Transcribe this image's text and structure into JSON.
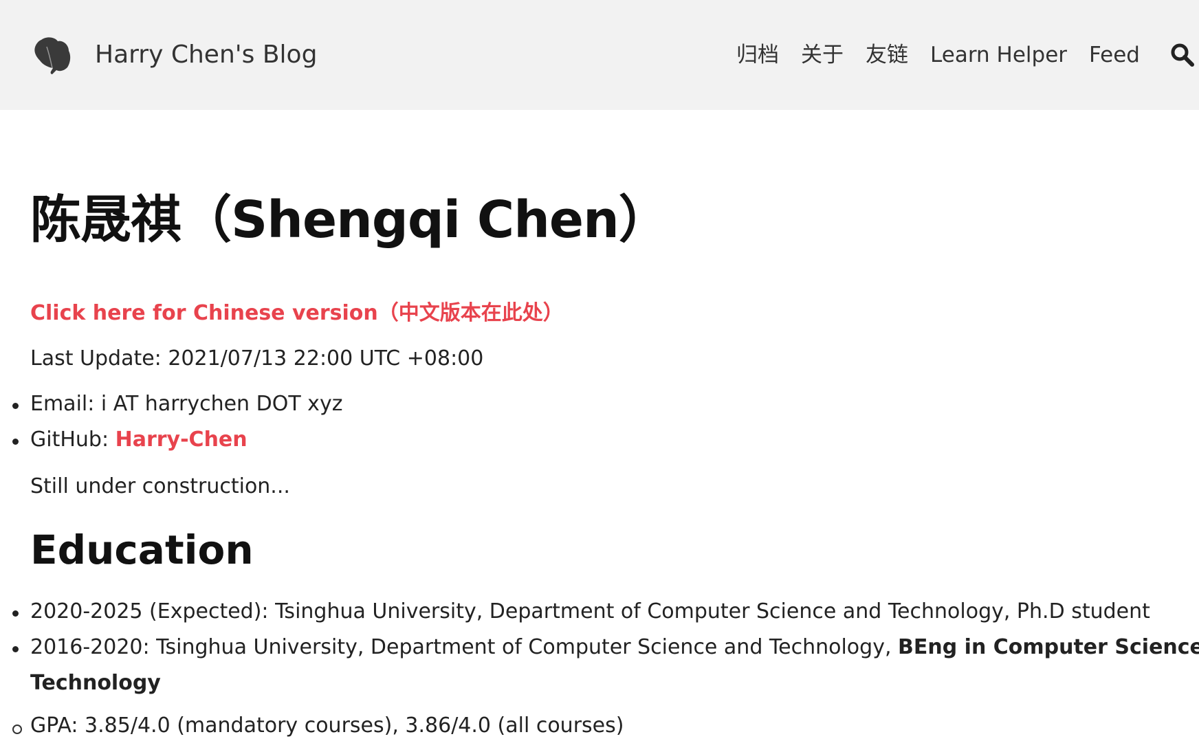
{
  "header": {
    "site_title": "Harry Chen's Blog",
    "nav": [
      "归档",
      "关于",
      "友链",
      "Learn Helper",
      "Feed"
    ]
  },
  "page": {
    "title": "陈晟祺（Shengqi Chen）",
    "chinese_link": "Click here for Chinese version（中文版本在此处）",
    "last_update": "Last Update: 2021/07/13 22:00 UTC +08:00",
    "contacts": {
      "email_label": "Email: i AT harrychen DOT xyz",
      "github_label": "GitHub: ",
      "github_link": "Harry-Chen"
    },
    "note": "Still under construction...",
    "education_heading": "Education",
    "education": {
      "item1": "2020-2025 (Expected): Tsinghua University, Department of Computer Science and Technology, Ph.D student",
      "item2_prefix": "2016-2020: Tsinghua University, Department of Computer Science and Technology, ",
      "item2_bold_a": "BEng in Computer Science and",
      "item2_bold_b": "Technology",
      "gpa": "GPA: 3.85/4.0 (mandatory courses), 3.86/4.0 (all courses)"
    }
  },
  "colors": {
    "accent": "#e8434d",
    "header_bg": "#f2f2f2"
  }
}
